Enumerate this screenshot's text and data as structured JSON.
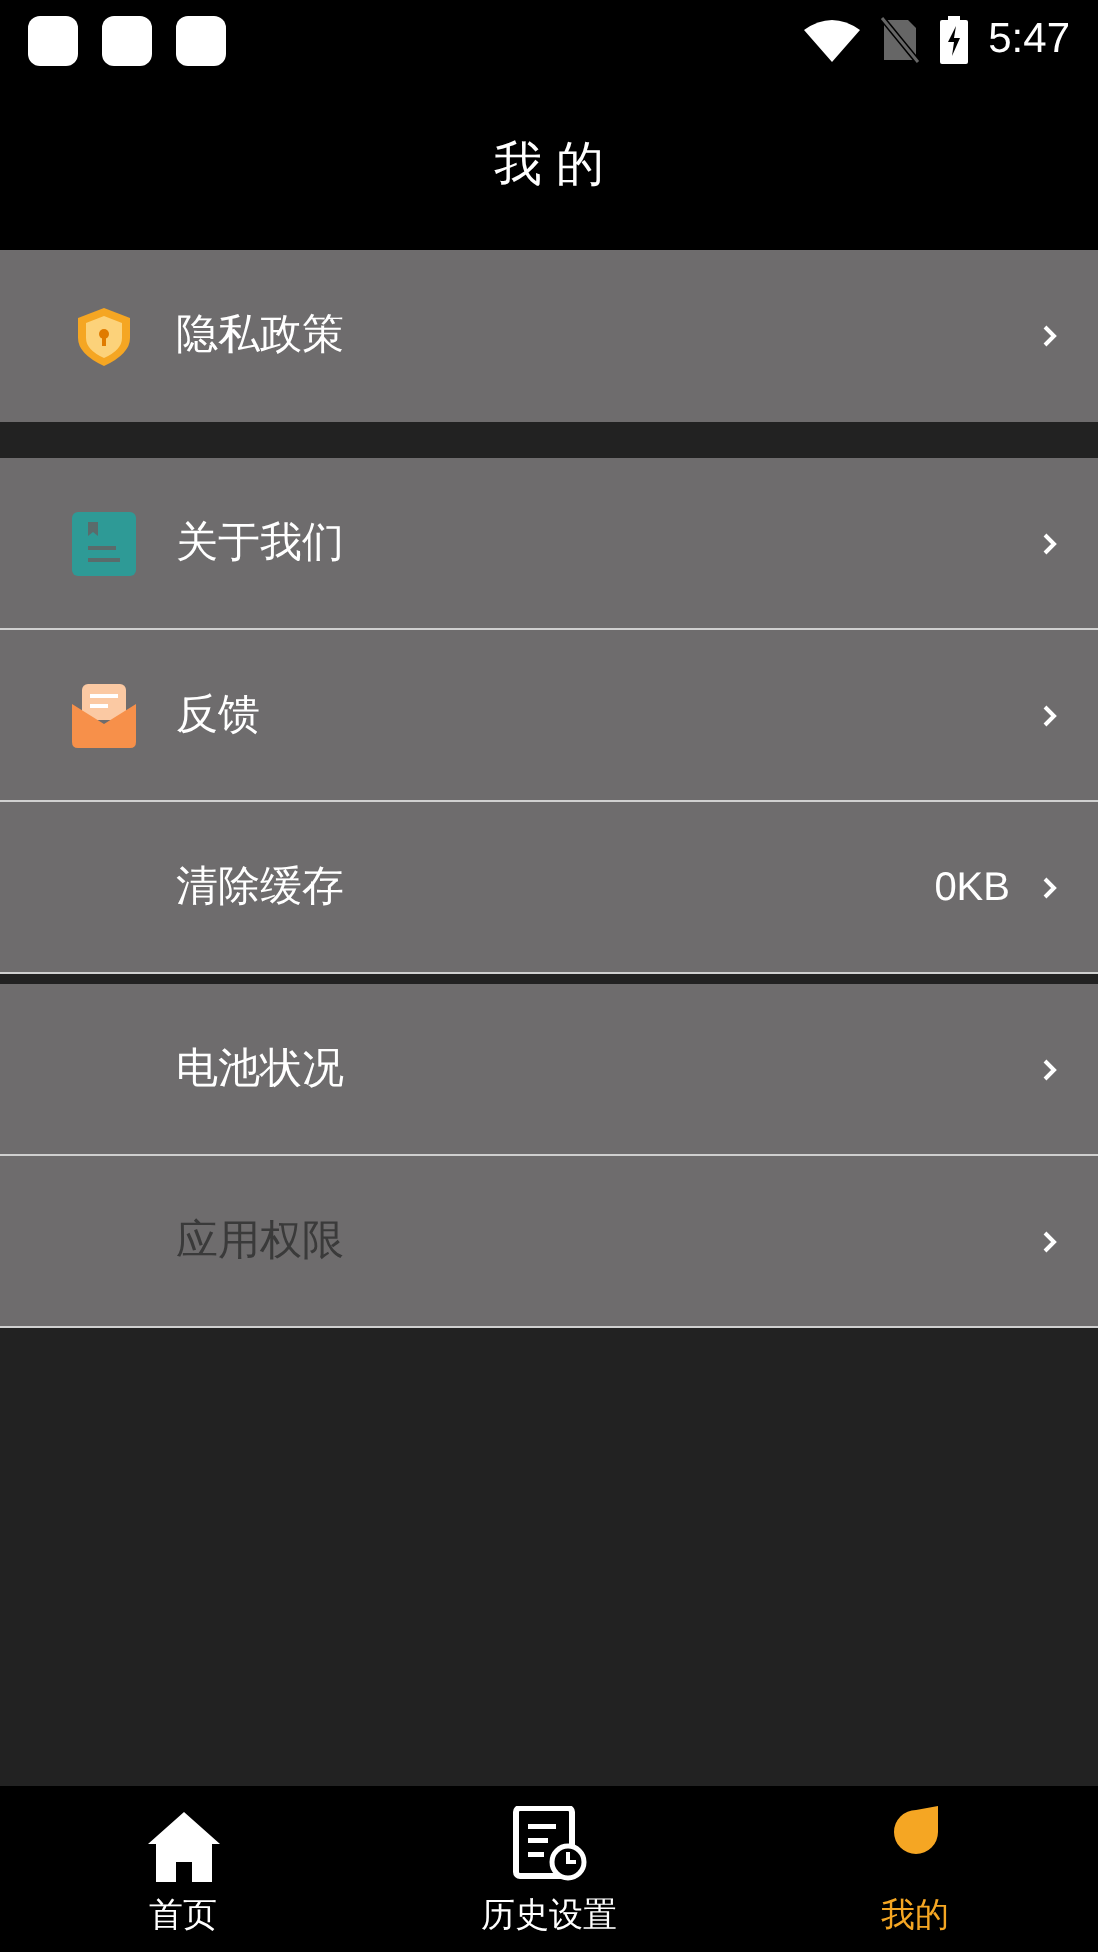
{
  "status_bar": {
    "time": "5:47"
  },
  "header": {
    "title": "我 的"
  },
  "groups": [
    {
      "items": [
        {
          "label": "隐私政策",
          "kind": "shield",
          "disabled": false
        }
      ]
    },
    {
      "items": [
        {
          "label": "关于我们",
          "kind": "contact",
          "disabled": false
        },
        {
          "label": "反馈",
          "kind": "mail",
          "disabled": false
        },
        {
          "label": "清除缓存",
          "kind": "plain",
          "value": "0KB",
          "disabled": false
        }
      ]
    },
    {
      "items": [
        {
          "label": "电池状况",
          "kind": "plain",
          "disabled": false
        },
        {
          "label": "应用权限",
          "kind": "plain",
          "disabled": true
        }
      ]
    }
  ],
  "bottom_nav": [
    {
      "label": "首页",
      "kind": "home",
      "selected": false
    },
    {
      "label": "历史设置",
      "kind": "history",
      "selected": false
    },
    {
      "label": "我的",
      "kind": "me",
      "selected": true
    }
  ]
}
